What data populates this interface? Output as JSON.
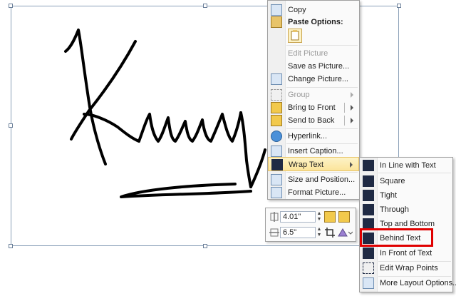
{
  "context_menu": {
    "copy": "Copy",
    "paste_options": "Paste Options:",
    "edit_picture": "Edit Picture",
    "save_as_picture": "Save as Picture...",
    "change_picture": "Change Picture...",
    "group": "Group",
    "bring_to_front": "Bring to Front",
    "send_to_back": "Send to Back",
    "hyperlink": "Hyperlink...",
    "insert_caption": "Insert Caption...",
    "wrap_text": "Wrap Text",
    "size_and_position": "Size and Position...",
    "format_picture": "Format Picture..."
  },
  "wrap_submenu": {
    "in_line": "In Line with Text",
    "square": "Square",
    "tight": "Tight",
    "through": "Through",
    "top_and_bottom": "Top and Bottom",
    "behind_text": "Behind Text",
    "in_front_of_text": "In Front of Text",
    "edit_wrap_points": "Edit Wrap Points",
    "more_layout_options": "More Layout Options..."
  },
  "mini_toolbar": {
    "height": "4.01\"",
    "width": "6.5\""
  },
  "colors": {
    "highlight": "#fbe49a",
    "annotation_box": "#e00000"
  }
}
